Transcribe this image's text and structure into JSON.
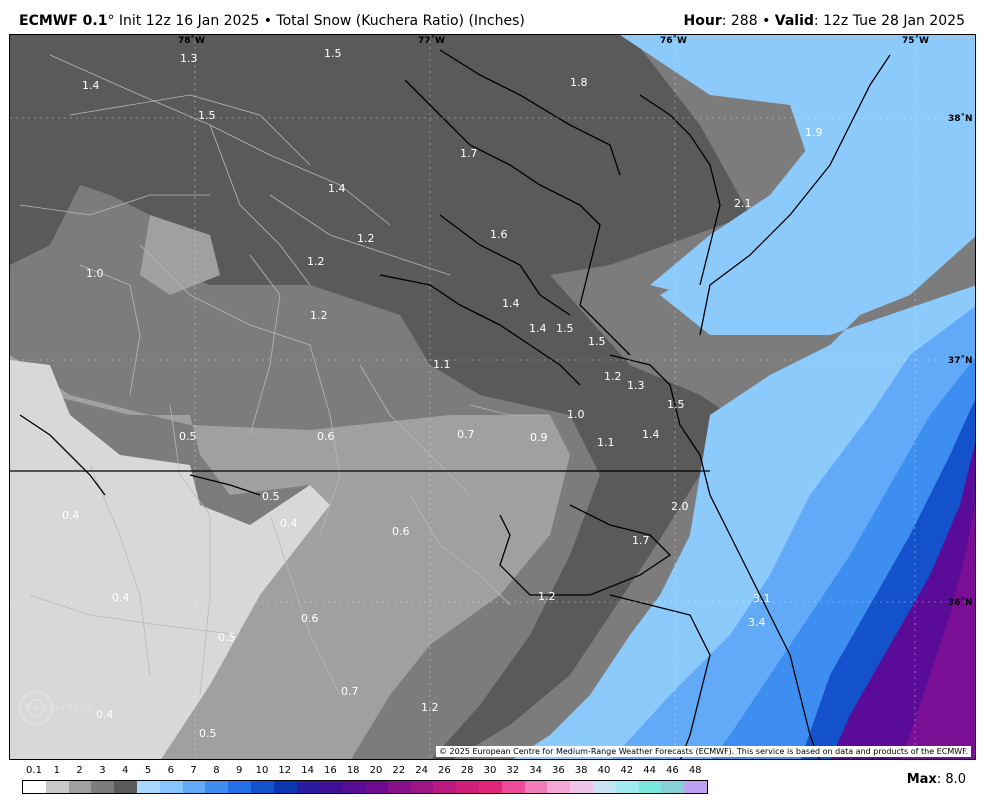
{
  "header": {
    "model": "ECMWF 0.1",
    "degree": "°",
    "init": " Init 12z 16 Jan 2025 • Total Snow (Kuchera Ratio) (Inches)",
    "hour_label": "Hour",
    "hour_value": ": 288 • ",
    "valid_label": "Valid",
    "valid_value": ": 12z Tue 28 Jan 2025"
  },
  "map": {
    "graticule": {
      "lon_labels": [
        "78˚W",
        "77˚W",
        "76˚W",
        "75˚W"
      ],
      "lat_labels": [
        "38˚N",
        "37˚N",
        "36˚N"
      ]
    },
    "snow_labels": [
      "1.3",
      "1.5",
      "1.4",
      "1.5",
      "1.8",
      "1.9",
      "1.7",
      "2.1",
      "1.4",
      "1.2",
      "1.6",
      "1.0",
      "1.2",
      "1.4",
      "1.2",
      "1.4",
      "1.5",
      "1.5",
      "1.1",
      "1.2",
      "1.3",
      "1.5",
      "1.0",
      "0.5",
      "0.6",
      "0.7",
      "0.9",
      "1.1",
      "1.4",
      "0.5",
      "0.4",
      "0.4",
      "2.0",
      "0.6",
      "1.7",
      "0.4",
      "1.2",
      "0.5",
      "0.6",
      "3.1",
      "3.4",
      "0.4",
      "0.7",
      "1.2",
      "0.5"
    ],
    "copyright": "© 2025 European Centre for Medium-Range Weather Forecasts (ECMWF). This service is based on data and products of the ECMWF.",
    "logo_text": "WeatherBELL"
  },
  "legend": {
    "labels": [
      "0.1",
      "1",
      "2",
      "3",
      "4",
      "5",
      "6",
      "7",
      "8",
      "9",
      "10",
      "12",
      "14",
      "16",
      "18",
      "20",
      "22",
      "24",
      "26",
      "28",
      "30",
      "32",
      "34",
      "36",
      "38",
      "40",
      "42",
      "44",
      "46",
      "48"
    ],
    "colors": [
      "#ffffff",
      "#c8c8c8",
      "#a0a0a0",
      "#7c7c7c",
      "#5a5a5a",
      "#a8d8ff",
      "#88c4ff",
      "#62aaf8",
      "#3e8ef2",
      "#2470e6",
      "#1452cc",
      "#0a36b0",
      "#2a1aa0",
      "#3f0f98",
      "#560c95",
      "#6c0a90",
      "#88108a",
      "#a01484",
      "#b81a80",
      "#d01e7a",
      "#e2267a",
      "#ee4a9a",
      "#f27cb8",
      "#f4a8d4",
      "#f0c4e8",
      "#c8e4f4",
      "#a0eaf2",
      "#78e8e0",
      "#88d0d8",
      "#c0a0f0"
    ],
    "max_label": "Max",
    "max_value": ": 8.0"
  },
  "colors": {
    "snow_0_1": "#ececec",
    "snow_0_5": "#c8c8c8",
    "snow_1": "#a0a0a0",
    "snow_1_5": "#7c7c7c",
    "snow_2": "#5a5a5a",
    "light_blue": "#8ccafc",
    "mid_blue": "#62aaf8",
    "blue": "#3e8ef2",
    "dark_blue": "#1452cc",
    "purple": "#5a0c98",
    "magenta": "#8a1090"
  }
}
